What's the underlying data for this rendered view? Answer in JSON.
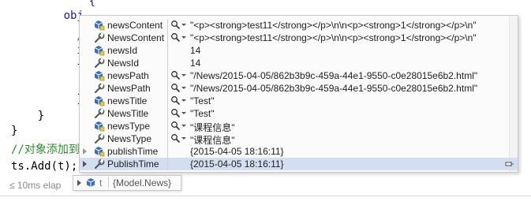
{
  "code": {
    "lines": [
      "      {",
      "      obj",
      "        /",
      "        i",
      "        {",
      "",
      "        }",
      "    }",
      "}",
      "//对象添加到",
      "ts.Add(t);"
    ]
  },
  "status": {
    "perf_tip": "≤ 10ms elap"
  },
  "datatip": {
    "rows": [
      {
        "name": "newsContent",
        "kind": "field",
        "has_viz": true,
        "value": "\"<p><strong>test11</strong></p>\\n\\n<p><strong>1</strong></p>\\n\""
      },
      {
        "name": "NewsContent",
        "kind": "property",
        "has_viz": true,
        "value": "\"<p><strong>test11</strong></p>\\n\\n<p><strong>1</strong></p>\\n\""
      },
      {
        "name": "newsId",
        "kind": "field",
        "has_viz": false,
        "value": "14"
      },
      {
        "name": "NewsId",
        "kind": "property",
        "has_viz": false,
        "value": "14"
      },
      {
        "name": "newsPath",
        "kind": "field",
        "has_viz": true,
        "value": "\"/News/2015-04-05/862b3b9c-459a-44e1-9550-c0e28015e6b2.html\""
      },
      {
        "name": "NewsPath",
        "kind": "property",
        "has_viz": true,
        "value": "\"/News/2015-04-05/862b3b9c-459a-44e1-9550-c0e28015e6b2.html\""
      },
      {
        "name": "newsTitle",
        "kind": "field",
        "has_viz": true,
        "value": "\"Test\""
      },
      {
        "name": "NewsTitle",
        "kind": "property",
        "has_viz": true,
        "value": "\"Test\""
      },
      {
        "name": "newsType",
        "kind": "field",
        "has_viz": true,
        "value": "\"课程信息\""
      },
      {
        "name": "NewsType",
        "kind": "property",
        "has_viz": true,
        "value": "\"课程信息\""
      },
      {
        "name": "publishTime",
        "kind": "field",
        "has_viz": false,
        "expandable": true,
        "value": "{2015-04-05 18:16:11}"
      },
      {
        "name": "PublishTime",
        "kind": "property",
        "has_viz": false,
        "expandable": true,
        "selected": true,
        "value": "{2015-04-05 18:16:11}"
      }
    ]
  },
  "summary_tip": {
    "name": "t",
    "value": "{Model.News}"
  },
  "colors": {
    "field_icon": "#3a6fb5",
    "property_icon": "#5a5a5a",
    "selection": "#d3dff0",
    "comment": "#2e8b2e"
  }
}
